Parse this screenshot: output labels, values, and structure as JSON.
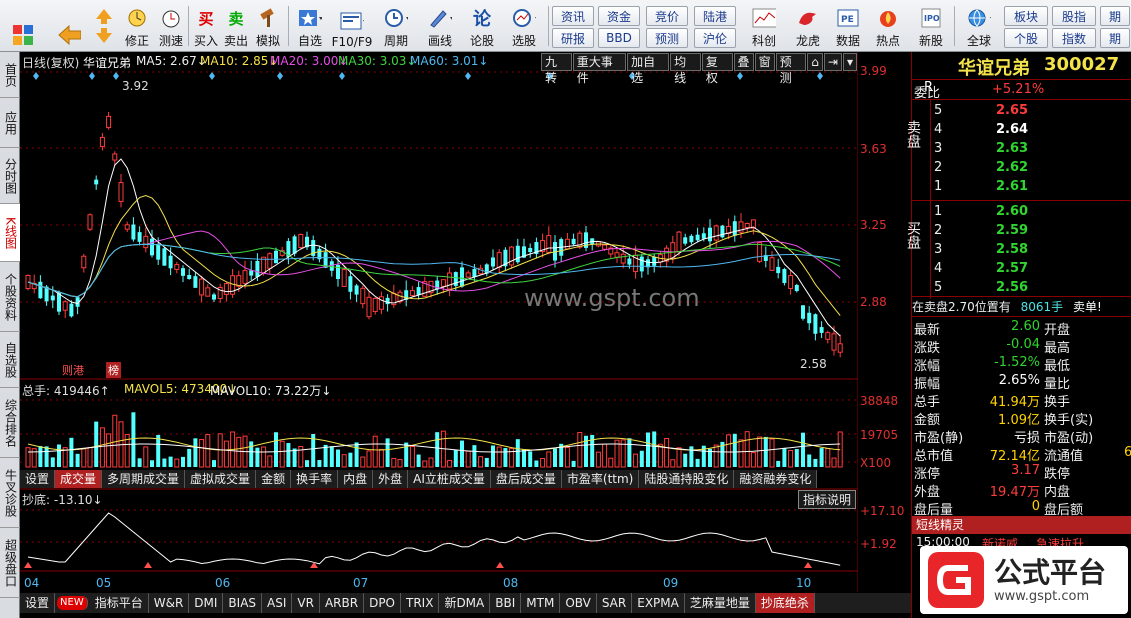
{
  "toolbar": {
    "buttons": [
      {
        "label": "",
        "icon": "grid-icon"
      },
      {
        "label": "",
        "icon": "back-arrow-icon"
      },
      {
        "label": "",
        "icon": "up-down-arrows-icon"
      },
      {
        "label": "修正",
        "icon": "clock-icon"
      },
      {
        "label": "测速",
        "icon": "timer-icon"
      },
      {
        "label": "买入",
        "icon_text": "买"
      },
      {
        "label": "卖出",
        "icon_text": "卖"
      },
      {
        "label": "模拟",
        "icon": "hammer-icon"
      },
      {
        "label": "自选",
        "icon": "star-icon"
      },
      {
        "label": "F10/F9",
        "icon": "f10-icon"
      },
      {
        "label": "周期",
        "icon": "period-icon"
      },
      {
        "label": "画线",
        "icon": "pen-icon"
      },
      {
        "label": "论股",
        "icon_text": "论"
      },
      {
        "label": "选股",
        "icon": "select-stock-icon"
      },
      {
        "label": "科创",
        "icon": "chart-icon"
      },
      {
        "label": "龙虎",
        "icon": "dragon-icon"
      },
      {
        "label": "数据",
        "icon": "pe-icon"
      },
      {
        "label": "热点",
        "icon": "hot-icon"
      },
      {
        "label": "新股",
        "icon": "ipo-icon"
      },
      {
        "label": "全球",
        "icon": "globe-icon"
      }
    ],
    "small_buttons": [
      "资讯",
      "资金",
      "竞价",
      "陆港",
      "研报",
      "BBD",
      "预测",
      "沪伦",
      "板块",
      "股指",
      "期",
      "个股",
      "指数",
      "期"
    ]
  },
  "left_tabs": [
    "首页",
    "应用",
    "分时图",
    "K线图",
    "个股资料",
    "自选股",
    "综合排名",
    "牛叉诊股",
    "超级盘口"
  ],
  "chart": {
    "header": {
      "title": "日线(复权)",
      "stock": "华谊兄弟",
      "ma5": "MA5: 2.67↓",
      "ma10": "MA10: 2.85↓",
      "ma20": "MA20: 3.00↓",
      "ma30": "MA30: 3.03↓",
      "ma60": "MA60: 3.01↓"
    },
    "tools": [
      "九转",
      "重大事件",
      "加自选",
      "均线",
      "复权",
      "叠",
      "窗",
      "预测"
    ],
    "high_label": "3.92",
    "low_label": "2.58",
    "watermark": "www.gspt.com",
    "badges": [
      "则港",
      "榜"
    ],
    "price_axis": [
      "3.99",
      "3.63",
      "3.25",
      "2.88"
    ],
    "volume_header": {
      "total": "总手: 419446↑",
      "mavol5": "MAVOL5: 473400↓",
      "mavol10": "MAVOL10: 73.22万↓"
    },
    "volume_axis": [
      "38848",
      "19705",
      "X100"
    ],
    "volume_tabs": [
      "设置",
      "成交量",
      "多周期成交量",
      "虚拟成交量",
      "金额",
      "换手率",
      "内盘",
      "外盘",
      "AI立桩成交量",
      "盘后成交量",
      "市盈率(ttm)",
      "陆股通持股变化",
      "融资融券变化"
    ],
    "indicator_header": "抄底: -13.10↓",
    "indicator_button": "指标说明",
    "indicator_axis": [
      "+17.10",
      "+1.92"
    ],
    "months": [
      "04",
      "05",
      "06",
      "07",
      "08",
      "09",
      "10"
    ]
  },
  "bottom_tabs": [
    "设置",
    "NEW",
    "指标平台",
    "W&R",
    "DMI",
    "BIAS",
    "ASI",
    "VR",
    "ARBR",
    "DPO",
    "TRIX",
    "新DMA",
    "BBI",
    "MTM",
    "OBV",
    "SAR",
    "EXPMA",
    "芝麻量地量",
    "抄底绝杀"
  ],
  "quote": {
    "name": "华谊兄弟",
    "code": "300027",
    "r": "R",
    "weibi_label": "委比",
    "weibi_value": "+5.21%",
    "sell_label": "卖盘",
    "buy_label": "买盘",
    "sells": [
      {
        "n": "5",
        "price": "2.65"
      },
      {
        "n": "4",
        "price": "2.64"
      },
      {
        "n": "3",
        "price": "2.63"
      },
      {
        "n": "2",
        "price": "2.62"
      },
      {
        "n": "1",
        "price": "2.61"
      }
    ],
    "buys": [
      {
        "n": "1",
        "price": "2.60"
      },
      {
        "n": "2",
        "price": "2.59"
      },
      {
        "n": "3",
        "price": "2.58"
      },
      {
        "n": "4",
        "price": "2.57"
      },
      {
        "n": "5",
        "price": "2.56"
      }
    ],
    "notice_a": "在卖盘2.70位置有",
    "notice_b": "8061手",
    "notice_c": "卖单!",
    "stats_left": [
      {
        "k": "最新",
        "v": "2.60",
        "c": "green"
      },
      {
        "k": "涨跌",
        "v": "-0.04",
        "c": "green"
      },
      {
        "k": "涨幅",
        "v": "-1.52%",
        "c": "green"
      },
      {
        "k": "振幅",
        "v": "2.65%",
        "c": "white"
      },
      {
        "k": "总手",
        "v": "41.94万",
        "c": "yellow"
      },
      {
        "k": "金额",
        "v": "1.09亿",
        "c": "yellow"
      },
      {
        "k": "市盈(静)",
        "v": "亏损",
        "c": "white"
      },
      {
        "k": "总市值",
        "v": "72.14亿",
        "c": "yellow"
      },
      {
        "k": "涨停",
        "v": "3.17",
        "c": "red"
      },
      {
        "k": "外盘",
        "v": "19.47万",
        "c": "red"
      },
      {
        "k": "盘后量",
        "v": "0",
        "c": "yellow"
      }
    ],
    "stats_right": [
      "开盘",
      "最高",
      "最低",
      "量比",
      "换手",
      "换手(实)",
      "市盈(动)",
      "流通值",
      "跌停",
      "内盘",
      "盘后额"
    ],
    "flow_value": "6",
    "short_title": "短线精灵",
    "short_time": "15:00:00",
    "short_stock": "新诺威",
    "short_event": "急速拉升"
  },
  "logo": {
    "text": "公式平台",
    "url": "www.gspt.com"
  }
}
